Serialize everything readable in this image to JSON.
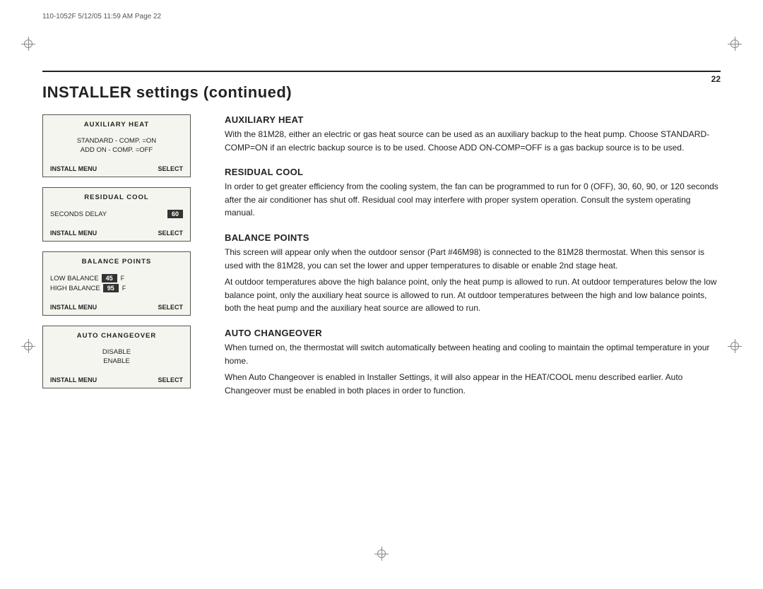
{
  "meta": {
    "line": "110-1052F  5/12/05  11:59 AM  Page 22",
    "page_number": "22"
  },
  "title": "INSTALLER settings (continued)",
  "screens": {
    "auxiliary_heat": {
      "title": "AUXILIARY HEAT",
      "line1": "STANDARD - COMP. =ON",
      "line2": "ADD ON - COMP. =OFF",
      "footer_left": "INSTALL MENU",
      "footer_right": "SELECT"
    },
    "residual_cool": {
      "title": "RESIDUAL COOL",
      "label": "SECONDS DELAY",
      "value": "60",
      "footer_left": "INSTALL MENU",
      "footer_right": "SELECT"
    },
    "balance_points": {
      "title": "BALANCE POINTS",
      "low_label": "LOW BALANCE",
      "low_value": "45",
      "low_unit": "F",
      "high_label": "HIGH BALANCE",
      "high_value": "95",
      "high_unit": "F",
      "footer_left": "INSTALL MENU",
      "footer_right": "SELECT"
    },
    "auto_changeover": {
      "title": "AUTO CHANGEOVER",
      "line1": "DISABLE",
      "line2": "ENABLE",
      "footer_left": "INSTALL MENU",
      "footer_right": "SELECT"
    }
  },
  "sections": {
    "auxiliary_heat": {
      "title": "AUXILIARY HEAT",
      "body": "With the 81M28, either an electric or gas heat source can be used as an auxiliary backup to the heat pump. Choose STANDARD-COMP=ON if an electric backup source is to be used. Choose ADD ON-COMP=OFF is a gas backup source is to be used."
    },
    "residual_cool": {
      "title": "RESIDUAL COOL",
      "body": "In order to get greater efficiency from the cooling system, the fan can be programmed to run for 0 (OFF), 30, 60, 90, or 120 seconds after the air conditioner has shut off. Residual cool may interfere with proper system operation. Consult the system operating manual."
    },
    "balance_points": {
      "title": "BALANCE POINTS",
      "body1": "This screen will appear only when the outdoor sensor (Part #46M98) is connected to the 81M28 thermostat. When this sensor is used with the 81M28, you can set the lower and upper temperatures to disable or enable 2nd stage heat.",
      "body2": "At outdoor temperatures above the high balance point, only the heat pump is allowed to run. At outdoor temperatures below the low balance point, only the auxiliary heat source is allowed to run. At outdoor temperatures between the high and low balance points, both the heat pump and the auxiliary heat source are allowed to run."
    },
    "auto_changeover": {
      "title": "AUTO CHANGEOVER",
      "body1": "When turned on, the thermostat will switch automatically between heating and cooling to maintain the optimal temperature in your home.",
      "body2": "When Auto Changeover is enabled in Installer Settings, it will also appear in the HEAT/COOL menu described earlier. Auto Changeover must be enabled in both places in order to function."
    }
  }
}
